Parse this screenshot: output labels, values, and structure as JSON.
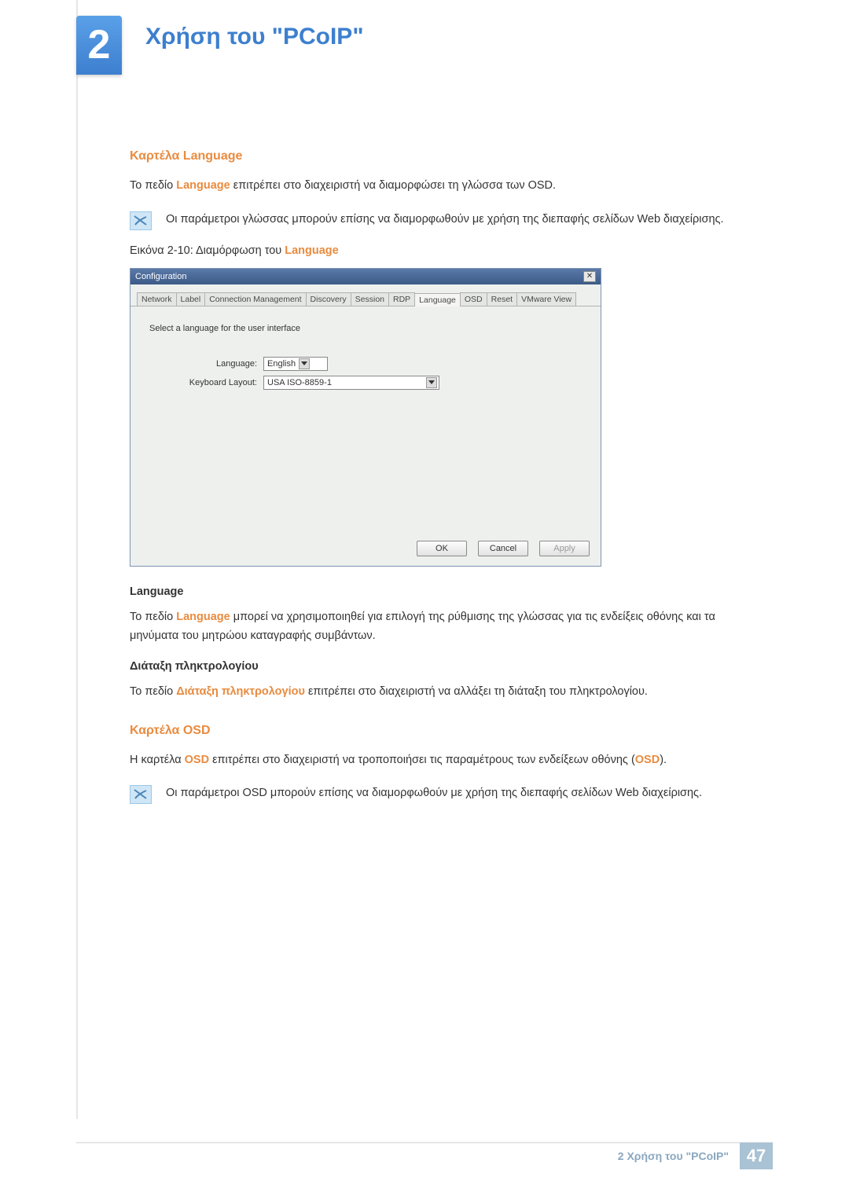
{
  "chapter": {
    "number": "2",
    "title": "Χρήση του \"PCoIP\""
  },
  "section_lang": {
    "heading": "Καρτέλα Language",
    "intro_pre": "Το πεδίο ",
    "intro_em": "Language",
    "intro_post": " επιτρέπει στο διαχειριστή να διαμορφώσει τη γλώσσα των OSD.",
    "note": "Οι παράμετροι γλώσσας μπορούν επίσης να διαμορφωθούν με χρήση της διεπαφής σελίδων Web διαχείρισης.",
    "caption_pre": "Εικόνα 2-10: Διαμόρφωση του ",
    "caption_em": "Language"
  },
  "config_window": {
    "title": "Configuration",
    "close": "✕",
    "tabs": [
      "Network",
      "Label",
      "Connection Management",
      "Discovery",
      "Session",
      "RDP",
      "Language",
      "OSD",
      "Reset",
      "VMware View"
    ],
    "selected_tab_index": 6,
    "instruction": "Select a language for the user interface",
    "rows": {
      "language": {
        "label": "Language:",
        "value": "English"
      },
      "keyboard": {
        "label": "Keyboard Layout:",
        "value": "USA ISO-8859-1"
      }
    },
    "buttons": {
      "ok": "OK",
      "cancel": "Cancel",
      "apply": "Apply"
    }
  },
  "lang_sub": {
    "heading": "Language",
    "p_pre": "Το πεδίο ",
    "p_em": "Language",
    "p_post": " μπορεί να χρησιμοποιηθεί για επιλογή της ρύθμισης της γλώσσας για τις ενδείξεις οθόνης και τα μηνύματα του μητρώου καταγραφής συμβάντων."
  },
  "kbd_sub": {
    "heading": "Διάταξη πληκτρολογίου",
    "p_pre": "Το πεδίο ",
    "p_em": "Διάταξη πληκτρολογίου",
    "p_post": " επιτρέπει στο διαχειριστή να αλλάξει τη διάταξη του πληκτρολογίου."
  },
  "section_osd": {
    "heading": "Καρτέλα OSD",
    "p_pre": "Η καρτέλα ",
    "p_em1": "OSD",
    "p_mid": " επιτρέπει στο διαχειριστή να τροποποιήσει τις παραμέτρους των ενδείξεων οθόνης (",
    "p_em2": "OSD",
    "p_post": ").",
    "note": "Οι παράμετροι OSD μπορούν επίσης να διαμορφωθούν με χρήση της διεπαφής σελίδων Web διαχείρισης."
  },
  "footer": {
    "text": "2 Χρήση του \"PCoIP\"",
    "page": "47"
  }
}
